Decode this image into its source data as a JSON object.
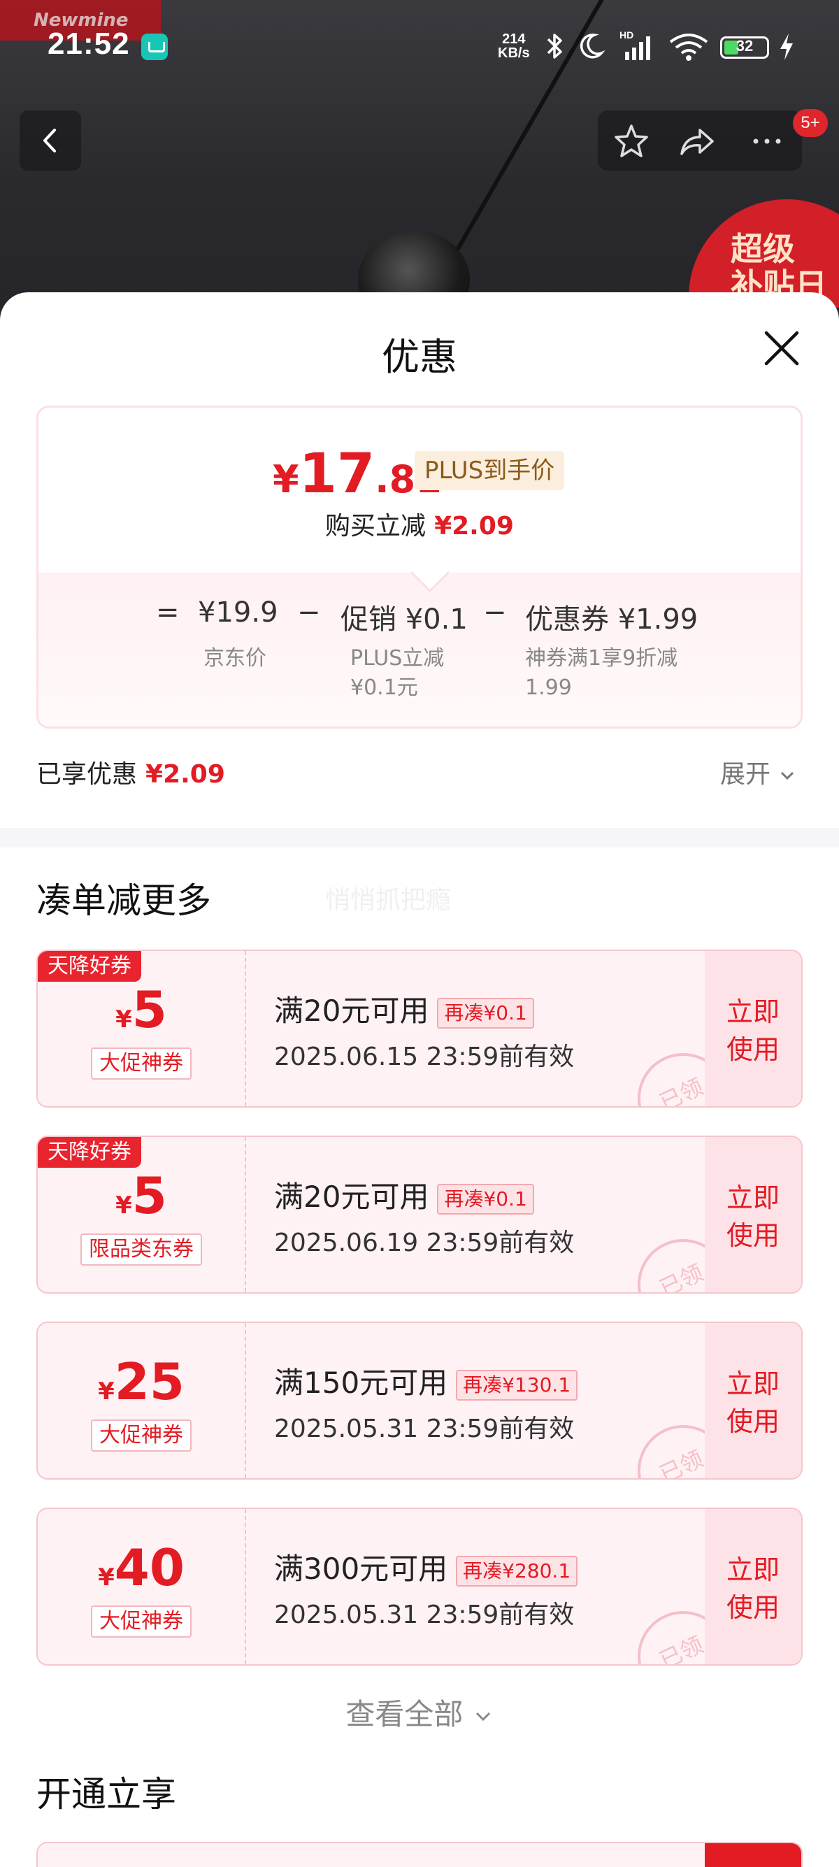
{
  "status_bar": {
    "brand": "Newmine",
    "time": "21:52",
    "net_speed_value": "214",
    "net_speed_unit": "KB/s",
    "network": "HD",
    "battery": "32"
  },
  "background": {
    "promo_text_1": "超级",
    "promo_text_2": "补贴日",
    "notification_badge": "5+"
  },
  "sheet": {
    "title": "优惠",
    "price_summary": {
      "currency": "¥",
      "price_int": "17",
      "price_dec": ".81",
      "plus_tag": "PLUS到手价",
      "reduce_label": "购买立减",
      "reduce_value": "¥2.09",
      "formula": {
        "equals": "=",
        "jd_price": "¥19.9",
        "minus1": "−",
        "promo": "促销 ¥0.1",
        "minus2": "−",
        "coupon": "优惠券 ¥1.99",
        "jd_label": "京东价",
        "plus_line1": "PLUS立减",
        "plus_line2": "¥0.1元",
        "coupon_line1": "神券满1享9折减",
        "coupon_line2": "1.99"
      }
    },
    "enjoyed_label": "已享优惠",
    "enjoyed_value": "¥2.09",
    "expand_label": "展开"
  },
  "more_section": {
    "title": "凑单减更多",
    "watermark": "悄悄抓把瘾",
    "coupons": [
      {
        "tag": "天降好券",
        "currency": "¥",
        "amount": "5",
        "kind": "大促神券",
        "condition": "满20元可用",
        "more": "再凑¥0.1",
        "date": "2025.06.15 23:59前有效",
        "use1": "立即",
        "use2": "使用",
        "stamp": "已领"
      },
      {
        "tag": "天降好券",
        "currency": "¥",
        "amount": "5",
        "kind": "限品类东券",
        "condition": "满20元可用",
        "more": "再凑¥0.1",
        "date": "2025.06.19 23:59前有效",
        "use1": "立即",
        "use2": "使用",
        "stamp": "已领"
      },
      {
        "tag": "",
        "currency": "¥",
        "amount": "25",
        "kind": "大促神券",
        "condition": "满150元可用",
        "more": "再凑¥130.1",
        "date": "2025.05.31 23:59前有效",
        "use1": "立即",
        "use2": "使用",
        "stamp": "已领"
      },
      {
        "tag": "",
        "currency": "¥",
        "amount": "40",
        "kind": "大促神券",
        "condition": "满300元可用",
        "more": "再凑¥280.1",
        "date": "2025.05.31 23:59前有效",
        "use1": "立即",
        "use2": "使用",
        "stamp": "已领"
      }
    ],
    "see_all": "查看全部"
  },
  "open_section": {
    "title": "开通立享"
  },
  "colors": {
    "accent_red": "#e31b23",
    "coupon_bg": "#fff2f4",
    "plus_gold": "#8a5b1d"
  }
}
